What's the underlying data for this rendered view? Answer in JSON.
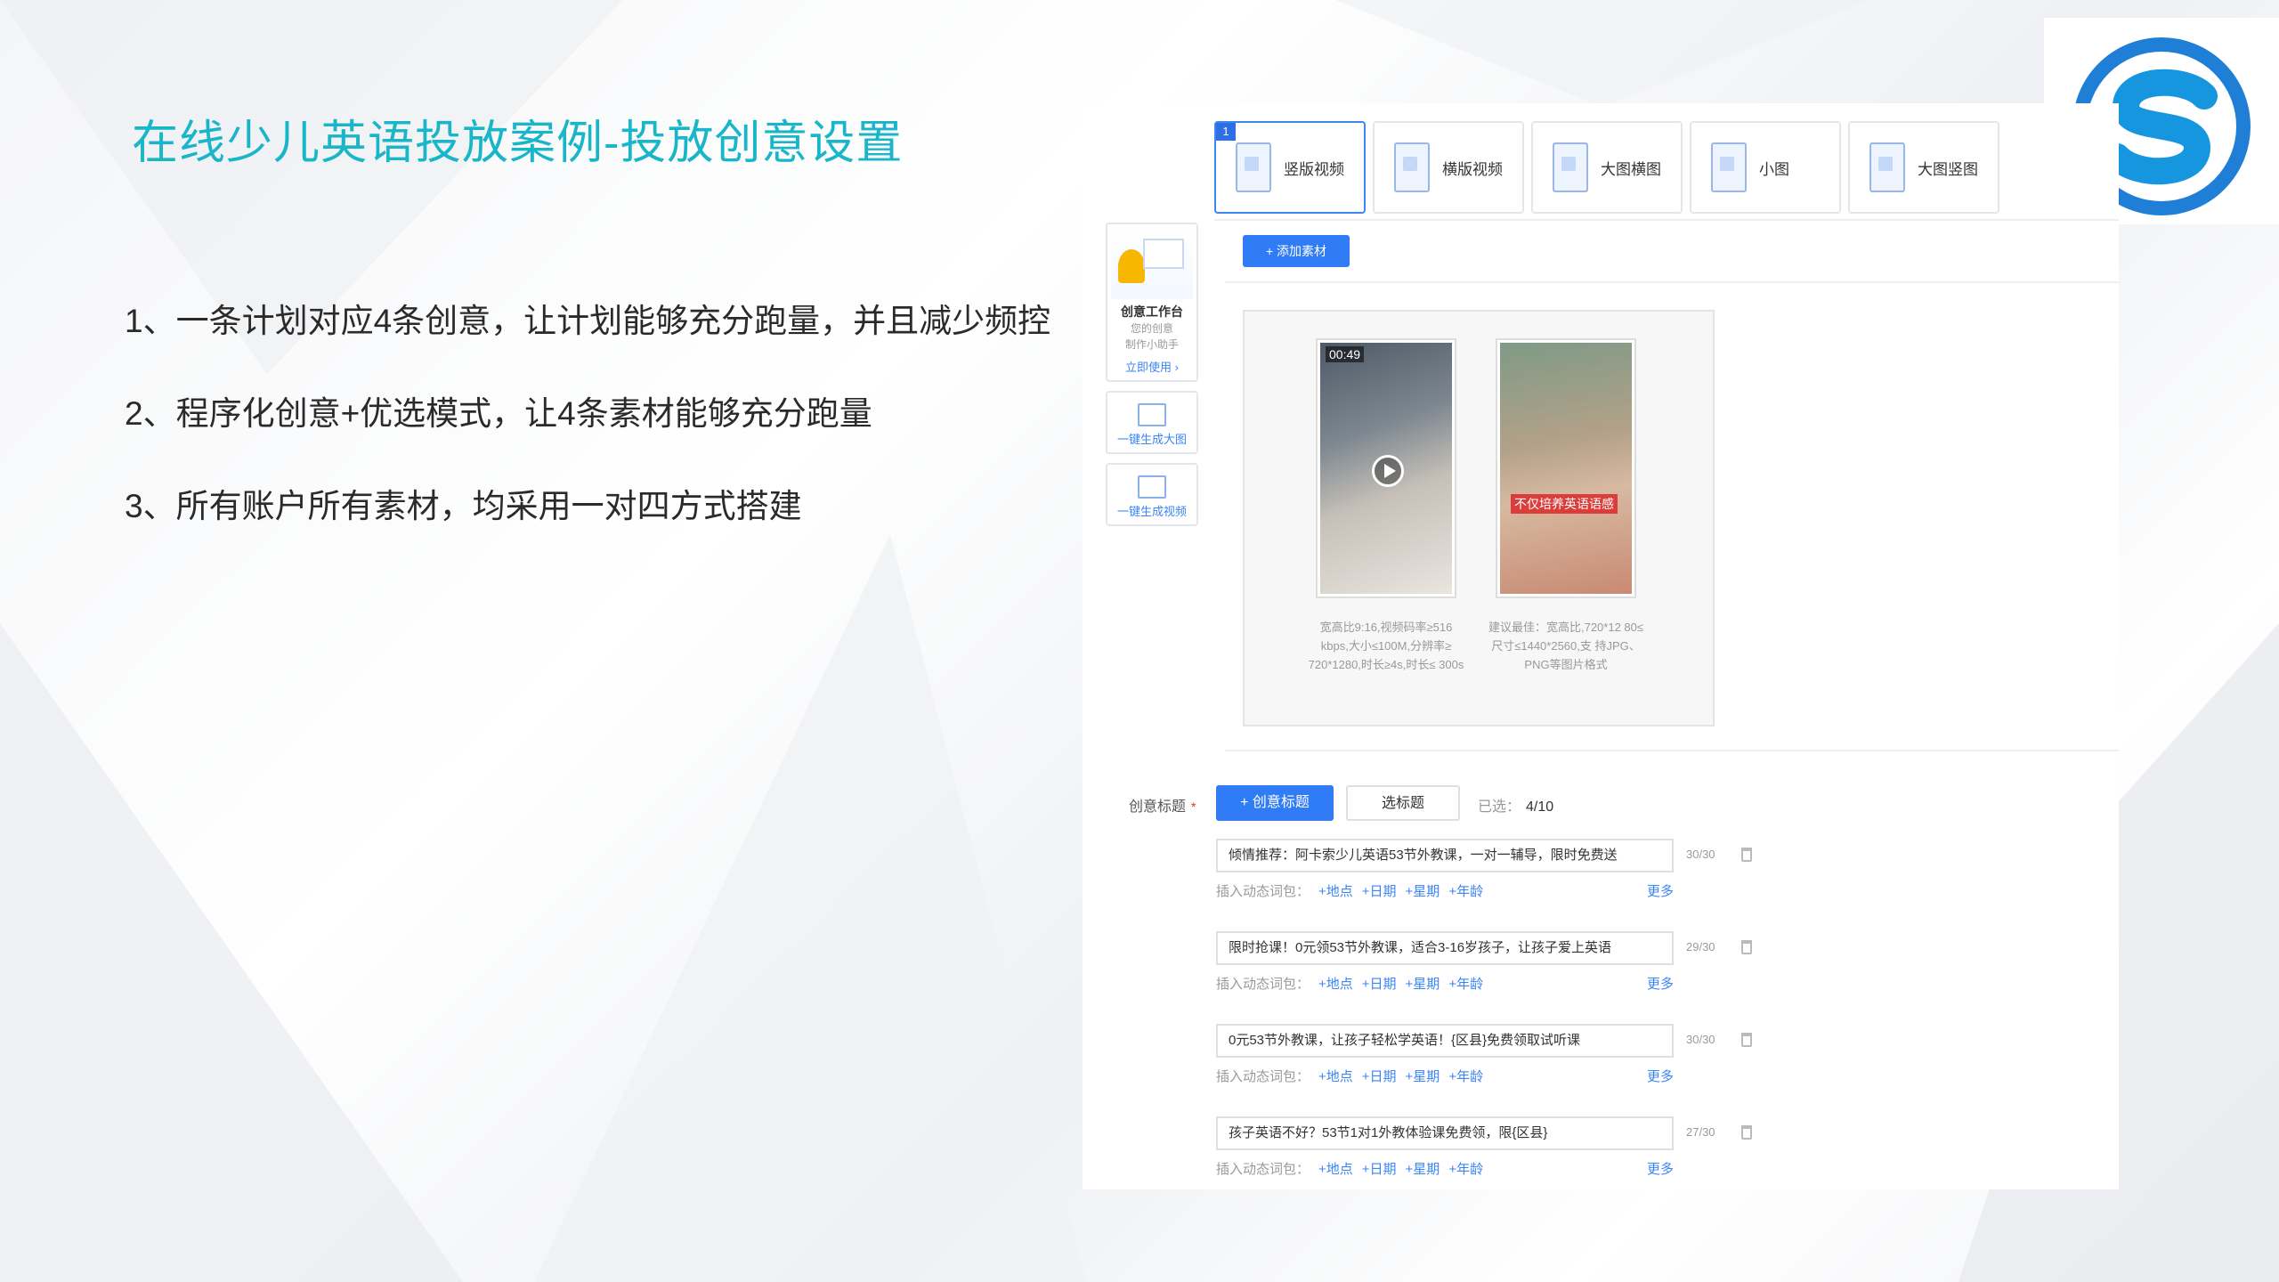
{
  "slide": {
    "title": "在线少儿英语投放案例-投放创意设置",
    "points": [
      "1、一条计划对应4条创意，让计划能够充分跑量，并且减少频控",
      "2、程序化创意+优选模式，让4条素材能够充分跑量",
      "3、所有账户所有素材，均采用一对四方式搭建"
    ]
  },
  "creative_types": [
    {
      "label": "竖版视频",
      "icon": "vertical-video-icon",
      "badge": "1",
      "active": true
    },
    {
      "label": "横版视频",
      "icon": "horizontal-video-icon"
    },
    {
      "label": "大图横图",
      "icon": "large-horizontal-image-icon"
    },
    {
      "label": "小图",
      "icon": "small-image-icon"
    },
    {
      "label": "大图竖图",
      "icon": "large-vertical-image-icon"
    }
  ],
  "sidebar": {
    "studio_title": "创意工作台",
    "studio_sub1": "您的创意",
    "studio_sub2": "制作小助手",
    "studio_link": "立即使用 ›",
    "gen_image": "一键生成大图",
    "gen_video": "一键生成视频"
  },
  "media": {
    "add_button": "+ 添加素材",
    "video_duration": "00:49",
    "image_overlay_text": "不仅培养英语语感",
    "video_spec": "宽高比9:16,视频码率≥516 kbps,大小≤100M,分辨率≥ 720*1280,时长≥4s,时长≤ 300s",
    "image_spec": "建议最佳：宽高比,720*12 80≤尺寸≤1440*2560,支 持JPG、PNG等图片格式"
  },
  "titles_section": {
    "label": "创意标题",
    "required_mark": "*",
    "create_button": "+ 创意标题",
    "select_button": "选标题",
    "selected_label": "已选：",
    "selected_value": "4/10",
    "dynamic_label": "插入动态词包：",
    "tags": [
      "+地点",
      "+日期",
      "+星期",
      "+年龄"
    ],
    "more": "更多",
    "items": [
      {
        "text": "倾情推荐：阿卡索少儿英语53节外教课，一对一辅导，限时免费送",
        "count": "30/30"
      },
      {
        "text": "限时抢课！0元领53节外教课，适合3-16岁孩子，让孩子爱上英语",
        "count": "29/30"
      },
      {
        "text": "0元53节外教课，让孩子轻松学英语！{区县}免费领取试听课",
        "count": "30/30"
      },
      {
        "text": "孩子英语不好？53节1对1外教体验课免费领，限{区县}",
        "count": "27/30"
      }
    ]
  },
  "colors": {
    "accent": "#19b6c9",
    "primary": "#2f7cf6",
    "logo_blue": "#1f7fd6"
  }
}
